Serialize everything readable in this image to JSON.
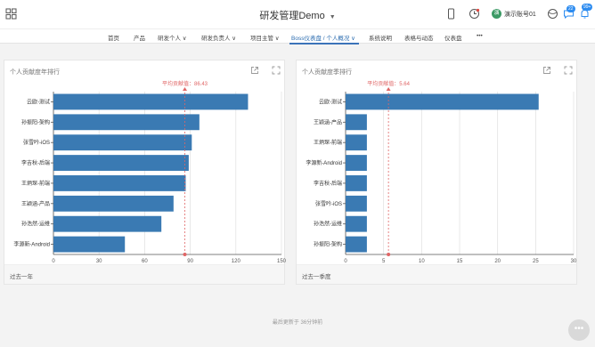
{
  "header": {
    "title": "研发管理Demo",
    "user_name": "演示账号01",
    "user_avatar_text": "演",
    "badge_a": "22",
    "badge_b": "99+"
  },
  "nav": {
    "items": [
      "首页",
      "产品",
      "研发个人 ∨",
      "研发负责人 ∨",
      "项目主管 ∨",
      "Boss仪表盘 / 个人概况 ∨",
      "系统说明",
      "表格与动态",
      "仪表盘",
      "•••"
    ]
  },
  "panels": [
    {
      "title": "个人贡献度年排行",
      "footer": "过去一年"
    },
    {
      "title": "个人贡献度季排行",
      "footer": "过去一季度"
    }
  ],
  "chart_data": [
    {
      "type": "bar",
      "orientation": "horizontal",
      "title": "个人贡献度年排行",
      "categories": [
        "云欧-测试",
        "孙振阳-架构",
        "张雪吟-iOS",
        "李吉秋-后端",
        "王炳琛-前端",
        "王颖涵-产品",
        "孙浩然-运维",
        "李源新-Android"
      ],
      "values": [
        128,
        96,
        91,
        89,
        87,
        79,
        71,
        47
      ],
      "xlim": [
        0,
        150
      ],
      "xticks": [
        0,
        30,
        60,
        90,
        120,
        150
      ],
      "average_label": "平均贡献值：86.43",
      "average": 86.43,
      "color": "#3a7ab3"
    },
    {
      "type": "bar",
      "orientation": "horizontal",
      "title": "个人贡献度季排行",
      "categories": [
        "云欧-测试",
        "王颖涵-产品",
        "王炳琛-前端",
        "李源新-Android",
        "李吉秋-后端",
        "张雪吟-iOS",
        "孙浩然-运维",
        "孙振阳-架构"
      ],
      "values": [
        25.4,
        2.8,
        2.8,
        2.8,
        2.8,
        2.8,
        2.8,
        2.8
      ],
      "xlim": [
        0,
        30
      ],
      "xticks": [
        0,
        5,
        10,
        15,
        20,
        25,
        30
      ],
      "average_label": "平均贡献值：5.64",
      "average": 5.64,
      "color": "#3a7ab3"
    }
  ],
  "footer": {
    "updated": "最后更新于 36分钟前",
    "fab_label": "•••"
  },
  "colors": {
    "bar": "#3a7ab3",
    "average_line": "#e06666",
    "accent": "#3b73b9"
  }
}
